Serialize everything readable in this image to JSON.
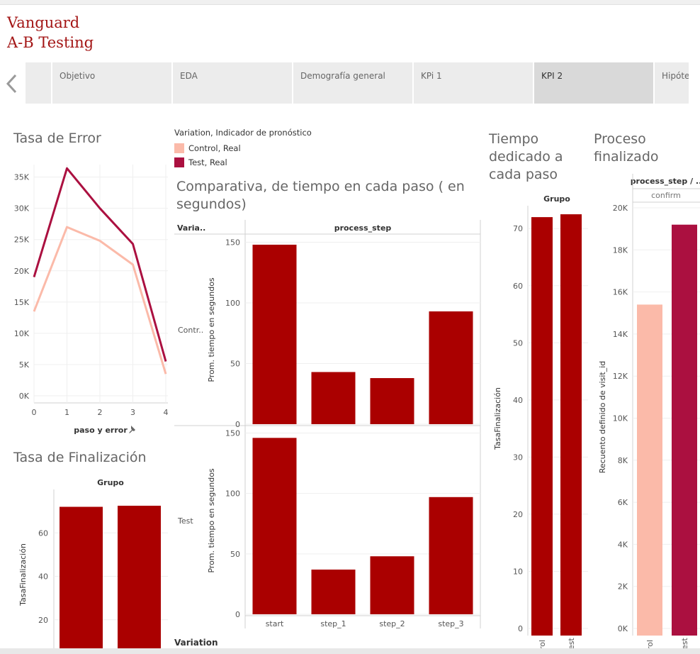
{
  "header": {
    "title_line1": "Vanguard",
    "title_line2": "A-B Testing"
  },
  "tabs": [
    {
      "label": "",
      "active": false
    },
    {
      "label": "Objetivo",
      "active": false
    },
    {
      "label": "EDA",
      "active": false
    },
    {
      "label": "Demografía general",
      "active": false
    },
    {
      "label": "KPi 1",
      "active": false
    },
    {
      "label": "KPI 2",
      "active": true
    },
    {
      "label": "Hipóte",
      "active": false
    }
  ],
  "colors": {
    "control": "#fbbaa9",
    "test": "#ab1040",
    "bar_dark": "#aa0000",
    "title_red": "#a31515"
  },
  "legend": {
    "title": "Variation, Indicador de pronóstico",
    "items": [
      {
        "label": "Control, Real",
        "color": "#fbbaa9"
      },
      {
        "label": "Test, Real",
        "color": "#ab1040"
      }
    ]
  },
  "footer_label": "Variation",
  "chart_data": [
    {
      "id": "error",
      "type": "line",
      "title": "Tasa de Error",
      "xlabel": "paso y error",
      "x": [
        0,
        1,
        2,
        3,
        4
      ],
      "yticks": [
        "0K",
        "5K",
        "10K",
        "15K",
        "20K",
        "25K",
        "30K",
        "35K"
      ],
      "ylim": [
        0,
        37000
      ],
      "series": [
        {
          "name": "Control",
          "color": "#fbbaa9",
          "values": [
            13500,
            27000,
            24800,
            21000,
            3500
          ]
        },
        {
          "name": "Test",
          "color": "#ab1040",
          "values": [
            19000,
            36400,
            30000,
            24300,
            5500
          ]
        }
      ]
    },
    {
      "id": "comparativa",
      "type": "bar",
      "title": "Comparativa, de tiempo en cada paso ( en segundos)",
      "row_header": "Varia..",
      "column_header": "process_step",
      "ylabel": "Prom. tiempo en segundos",
      "categories": [
        "start",
        "step_1",
        "step_2",
        "step_3"
      ],
      "ylim": [
        0,
        155
      ],
      "yticks": [
        "0",
        "50",
        "100",
        "150"
      ],
      "series": [
        {
          "name": "Contr..",
          "values": [
            148,
            43,
            38,
            93
          ]
        },
        {
          "name": "Test",
          "values": [
            146,
            37,
            48,
            97
          ]
        }
      ]
    },
    {
      "id": "finalizacion",
      "type": "bar",
      "title": "Tasa de Finalización",
      "column_header": "Grupo",
      "ylabel": "TasaFinalización",
      "yticks": [
        "20",
        "40",
        "60"
      ],
      "ylim": [
        0,
        80
      ],
      "values": [
        72,
        72.5
      ]
    },
    {
      "id": "tiempo",
      "type": "bar",
      "title": "Tiempo dedicado a cada paso",
      "column_header": "Grupo",
      "ylabel": "TasaFinalización",
      "categories": [
        "rol",
        "est"
      ],
      "yticks": [
        "0",
        "10",
        "20",
        "30",
        "40",
        "50",
        "60",
        "70"
      ],
      "ylim": [
        0,
        74
      ],
      "values": [
        72,
        72.5
      ]
    },
    {
      "id": "proceso",
      "type": "bar",
      "title": "Proceso finalizado",
      "column_header": "process_step / ..",
      "sub_header": "confirm",
      "ylabel": "Recuento definido de visit_id",
      "categories": [
        "rol",
        "est"
      ],
      "yticks": [
        "0K",
        "2K",
        "4K",
        "6K",
        "8K",
        "10K",
        "12K",
        "14K",
        "16K",
        "18K",
        "20K"
      ],
      "ylim": [
        0,
        20000
      ],
      "series": [
        {
          "name": "Control",
          "color": "#fbbaa9",
          "value": 15400
        },
        {
          "name": "Test",
          "color": "#ab1040",
          "value": 19200
        }
      ]
    }
  ]
}
